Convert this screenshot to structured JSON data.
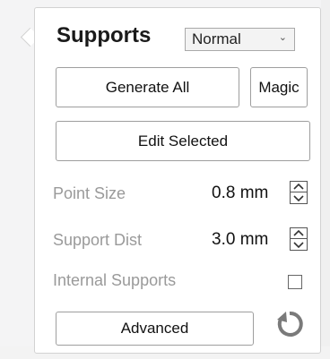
{
  "panel": {
    "title": "Supports",
    "mode_select": {
      "value": "Normal"
    },
    "buttons": {
      "generate_all": "Generate All",
      "magic": "Magic",
      "edit_selected": "Edit Selected",
      "advanced": "Advanced"
    },
    "settings": {
      "point_size": {
        "label": "Point Size",
        "value": "0.8 mm"
      },
      "support_dist": {
        "label": "Support Dist",
        "value": "3.0 mm"
      },
      "internal_supports": {
        "label": "Internal Supports",
        "checked": false
      }
    },
    "icons": [
      "chevron-down-icon",
      "spinner-up-icon",
      "spinner-down-icon",
      "refresh-icon"
    ]
  }
}
